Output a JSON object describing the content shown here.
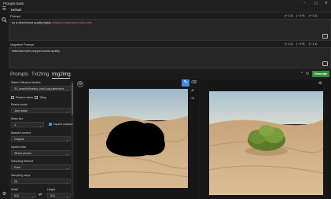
{
  "window": {
    "title": "Prompts Bank",
    "minimize": "–",
    "maximize": "▢",
    "close": "✕"
  },
  "preset": {
    "label": "Default"
  },
  "prompt": {
    "title": "Prompt",
    "text_before": "on a desert,best quality,highly ",
    "text_highlight": "detailed,masterpiece,ultra-fine",
    "counters": [
      "(+ 1.1)",
      "(− 0.9)",
      "(+ 1.1)"
    ]
  },
  "negative_prompt": {
    "title": "Negative Prompt",
    "text": "nsfw,bad eyes,cropped,worst quality",
    "counters": [
      "(+ 1.1)",
      "(− 0.9)",
      "(+ 1.1)"
    ]
  },
  "tabs": [
    {
      "label": "Prompts"
    },
    {
      "label": "Txt2Img"
    },
    {
      "label": "Img2img"
    }
  ],
  "generate_label": "Generate",
  "form": {
    "model_label": "Stable Diffusion Models",
    "model_value": "SD_beautifulRealistic_brav5.png.safetensors",
    "restore_faces": "Restore faces",
    "tiling": "Tiling",
    "resize_mode_label": "Resize mode",
    "resize_mode_value": "Just resize",
    "mask_blur_label": "Mask blur",
    "mask_blur_value": "4",
    "inpaint_masked": "Inpaint masked",
    "masked_content_label": "Masked content",
    "masked_content_value": "Original",
    "inpaint_area_label": "Inpaint area",
    "inpaint_area_value": "Whole picture",
    "sampling_method_label": "Sampling Method",
    "sampling_method_value": "Euler",
    "sampling_steps_label": "Sampling steps",
    "sampling_steps_value": "20",
    "width_label": "Width",
    "width_value": "512",
    "height_label": "Height",
    "height_value": "512"
  },
  "colors": {
    "accent_blue": "#3c8fe0",
    "generate_green": "#2f8f3a",
    "highlight_red": "#e06060"
  }
}
